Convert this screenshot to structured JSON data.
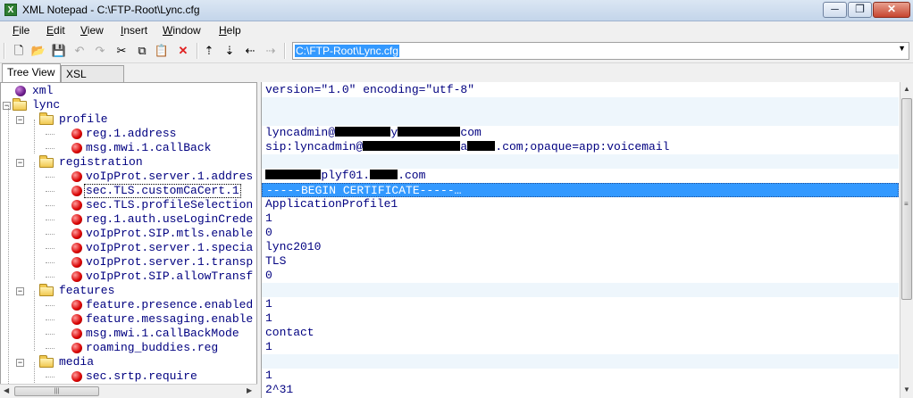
{
  "window": {
    "app_icon": "X",
    "title": "XML Notepad - C:\\FTP-Root\\Lync.cfg",
    "min_glyph": "─",
    "max_glyph": "❐",
    "close_glyph": "✕"
  },
  "menu": [
    {
      "key": "F",
      "rest": "ile"
    },
    {
      "key": "E",
      "rest": "dit"
    },
    {
      "key": "V",
      "rest": "iew"
    },
    {
      "key": "I",
      "rest": "nsert"
    },
    {
      "key": "W",
      "rest": "indow"
    },
    {
      "key": "H",
      "rest": "elp"
    }
  ],
  "toolbar": {
    "icons": [
      {
        "name": "new-file-icon",
        "glyph": "🗋",
        "enabled": true
      },
      {
        "name": "open-folder-icon",
        "glyph": "📂",
        "enabled": true
      },
      {
        "name": "save-icon",
        "glyph": "💾",
        "enabled": true
      },
      {
        "name": "undo-icon",
        "glyph": "↶",
        "enabled": false
      },
      {
        "name": "redo-icon",
        "glyph": "↷",
        "enabled": false
      },
      {
        "name": "cut-icon",
        "glyph": "✂",
        "enabled": true
      },
      {
        "name": "copy-icon",
        "glyph": "⧉",
        "enabled": true
      },
      {
        "name": "paste-icon",
        "glyph": "📋",
        "enabled": true
      },
      {
        "name": "delete-icon",
        "glyph": "✕",
        "enabled": true,
        "color": "#e02020"
      },
      {
        "name": "nudge-up-icon",
        "glyph": "⇡",
        "enabled": true
      },
      {
        "name": "nudge-down-icon",
        "glyph": "⇣",
        "enabled": true
      },
      {
        "name": "nudge-left-icon",
        "glyph": "⇠",
        "enabled": true
      },
      {
        "name": "nudge-right-icon",
        "glyph": "⇢",
        "enabled": false
      }
    ],
    "address": "C:\\FTP-Root\\Lync.cfg"
  },
  "tabs": [
    {
      "label": "Tree View",
      "active": true
    },
    {
      "label": "XSL Output",
      "active": false
    }
  ],
  "tree": [
    {
      "label": "xml",
      "type": "pi",
      "depth": 0
    },
    {
      "label": "lync",
      "type": "folder",
      "depth": 0,
      "expanded": true
    },
    {
      "label": "profile",
      "type": "folder",
      "depth": 1,
      "expanded": true
    },
    {
      "label": "reg.1.address",
      "type": "attr",
      "depth": 2
    },
    {
      "label": "msg.mwi.1.callBack",
      "type": "attr",
      "depth": 2
    },
    {
      "label": "registration",
      "type": "folder",
      "depth": 1,
      "expanded": true
    },
    {
      "label": "voIpProt.server.1.addres",
      "type": "attr",
      "depth": 2
    },
    {
      "label": "sec.TLS.customCaCert.1",
      "type": "attr",
      "depth": 2,
      "selected": true
    },
    {
      "label": "sec.TLS.profileSelection",
      "type": "attr",
      "depth": 2
    },
    {
      "label": "reg.1.auth.useLoginCrede",
      "type": "attr",
      "depth": 2
    },
    {
      "label": "voIpProt.SIP.mtls.enable",
      "type": "attr",
      "depth": 2
    },
    {
      "label": "voIpProt.server.1.specia",
      "type": "attr",
      "depth": 2
    },
    {
      "label": "voIpProt.server.1.transp",
      "type": "attr",
      "depth": 2
    },
    {
      "label": "voIpProt.SIP.allowTransf",
      "type": "attr",
      "depth": 2
    },
    {
      "label": "features",
      "type": "folder",
      "depth": 1,
      "expanded": true
    },
    {
      "label": "feature.presence.enabled",
      "type": "attr",
      "depth": 2
    },
    {
      "label": "feature.messaging.enable",
      "type": "attr",
      "depth": 2
    },
    {
      "label": "msg.mwi.1.callBackMode",
      "type": "attr",
      "depth": 2
    },
    {
      "label": "roaming_buddies.reg",
      "type": "attr",
      "depth": 2
    },
    {
      "label": "media",
      "type": "folder",
      "depth": 1,
      "expanded": true
    },
    {
      "label": "sec.srtp.require",
      "type": "attr",
      "depth": 2
    }
  ],
  "values": [
    [
      {
        "t": "version=\"1.0\" encoding=\"utf-8\""
      }
    ],
    [],
    [],
    [
      {
        "t": "lyncadmin@"
      },
      {
        "redact": 8
      },
      {
        "t": "y"
      },
      {
        "redact": 9
      },
      {
        "t": "com"
      }
    ],
    [
      {
        "t": "sip:lyncadmin@"
      },
      {
        "redact": 14
      },
      {
        "t": "a"
      },
      {
        "redact": 4
      },
      {
        "t": ".com;opaque=app:voicemail"
      }
    ],
    [],
    [
      {
        "redact": 8
      },
      {
        "t": "plyf01."
      },
      {
        "redact": 4
      },
      {
        "t": ".com"
      }
    ],
    [
      {
        "t": "-----BEGIN CERTIFICATE-----…"
      }
    ],
    [
      {
        "t": "ApplicationProfile1"
      }
    ],
    [
      {
        "t": "1"
      }
    ],
    [
      {
        "t": "0"
      }
    ],
    [
      {
        "t": "lync2010"
      }
    ],
    [
      {
        "t": "TLS"
      }
    ],
    [
      {
        "t": "0"
      }
    ],
    [],
    [
      {
        "t": "1"
      }
    ],
    [
      {
        "t": "1"
      }
    ],
    [
      {
        "t": "contact"
      }
    ],
    [
      {
        "t": "1"
      }
    ],
    [],
    [
      {
        "t": "1"
      }
    ],
    [
      {
        "t": "2^31"
      }
    ]
  ],
  "scrollbars": {
    "up": "▲",
    "down": "▼",
    "left": "◀",
    "right": "▶",
    "grip": "≡",
    "hgrip": "|||"
  }
}
